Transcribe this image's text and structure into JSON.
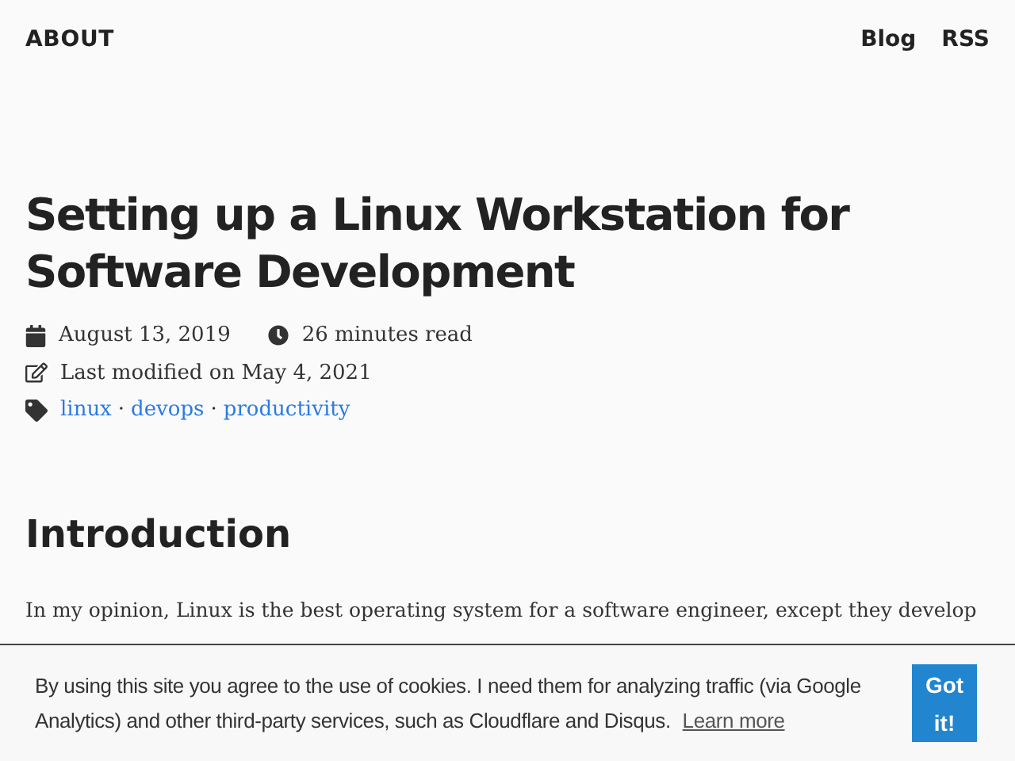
{
  "header": {
    "title": "ABOUT",
    "nav": [
      "Blog",
      "RSS"
    ]
  },
  "post": {
    "title": "Setting up a Linux Workstation for Software Development",
    "date": "August 13, 2019",
    "read_time": "26 minutes read",
    "modified": "Last modified on May 4, 2021",
    "tags": [
      "linux",
      "devops",
      "productivity"
    ],
    "separator": "·"
  },
  "section": {
    "heading": "Introduction",
    "paragraph": "In my opinion, Linux is the best operating system for a software engineer, except they develop"
  },
  "cookie_banner": {
    "text": "By using this site you agree to the use of cookies. I need them for analyzing traffic (via Google Analytics) and other third-party services, such as Cloudflare and Disqus.",
    "link": "Learn more",
    "button": "Got it!"
  }
}
